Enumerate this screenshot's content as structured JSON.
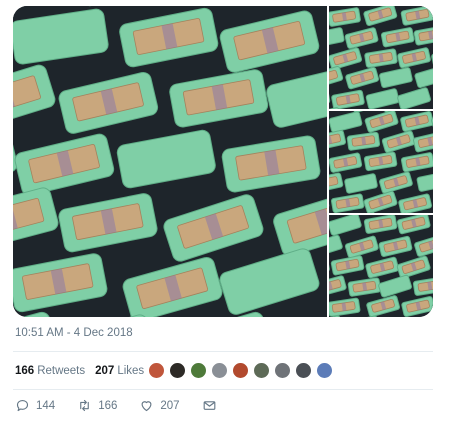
{
  "tweet": {
    "timestamp": "10:51 AM - 4 Dec 2018",
    "stats": {
      "retweets_count": "166",
      "retweets_label": "Retweets",
      "likes_count": "207",
      "likes_label": "Likes"
    },
    "liker_avatars": [
      "#c0563b",
      "#2d2a26",
      "#4e7a3a",
      "#8a8f96",
      "#b24a2e",
      "#5d6a57",
      "#6f7378",
      "#4a4f55",
      "#5c7cb8"
    ],
    "actions": {
      "reply_count": "144",
      "retweet_count": "166",
      "like_count": "207"
    },
    "media": {
      "photo_count": 4
    }
  },
  "colors": {
    "container_green": "#7fcfa6",
    "banknote": "#c9a77d",
    "secondary_text": "#657786"
  }
}
